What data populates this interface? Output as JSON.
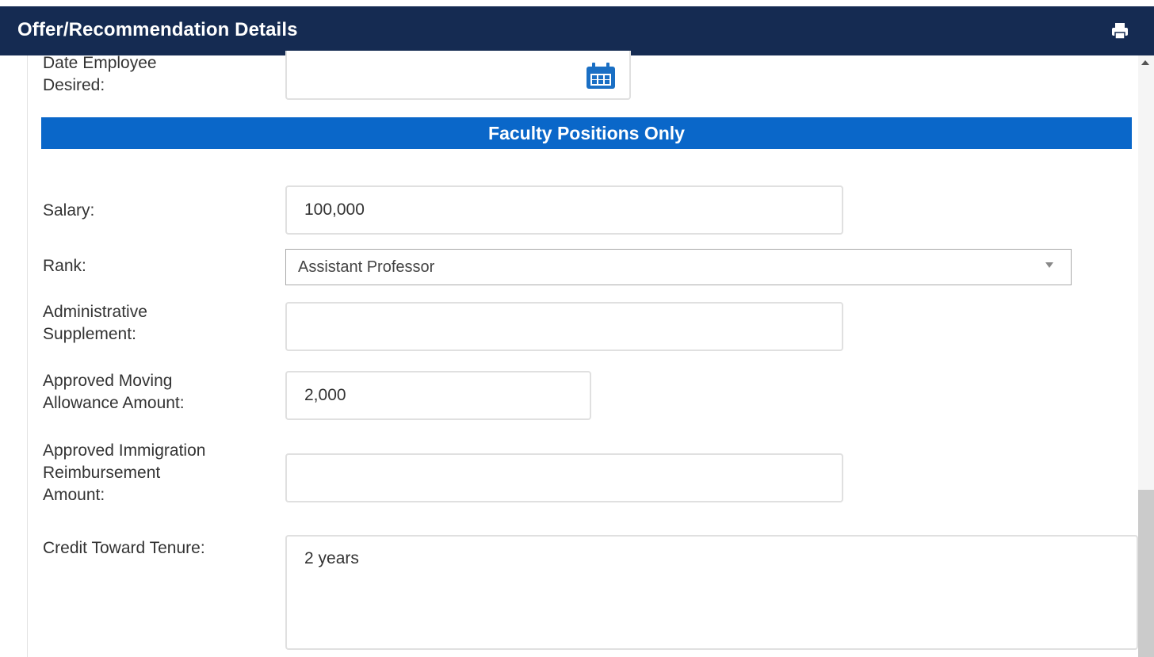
{
  "header": {
    "title": "Offer/Recommendation Details",
    "print_icon": "print-icon"
  },
  "section": {
    "title": "Faculty Positions Only",
    "color": "#0a67c9"
  },
  "colors": {
    "header_bg": "#152b52",
    "section_bg": "#0a67c9",
    "icon": "#1a6fc4"
  },
  "fields": {
    "date_desired": {
      "label_line1": "Date Employee",
      "label_line2": "Desired:",
      "value": "",
      "icon": "calendar-icon"
    },
    "salary": {
      "label": "Salary:",
      "value": "100,000"
    },
    "rank": {
      "label": "Rank:",
      "value": "Assistant Professor"
    },
    "admin_supplement": {
      "label_line1": "Administrative",
      "label_line2": "Supplement:",
      "value": ""
    },
    "moving_allowance": {
      "label_line1": "Approved Moving",
      "label_line2": "Allowance Amount:",
      "value": "2,000"
    },
    "immigration": {
      "label_line1": "Approved Immigration",
      "label_line2": "Reimbursement",
      "label_line3": "Amount:",
      "value": ""
    },
    "tenure_credit": {
      "label": "Credit Toward Tenure:",
      "value": "2 years"
    }
  }
}
